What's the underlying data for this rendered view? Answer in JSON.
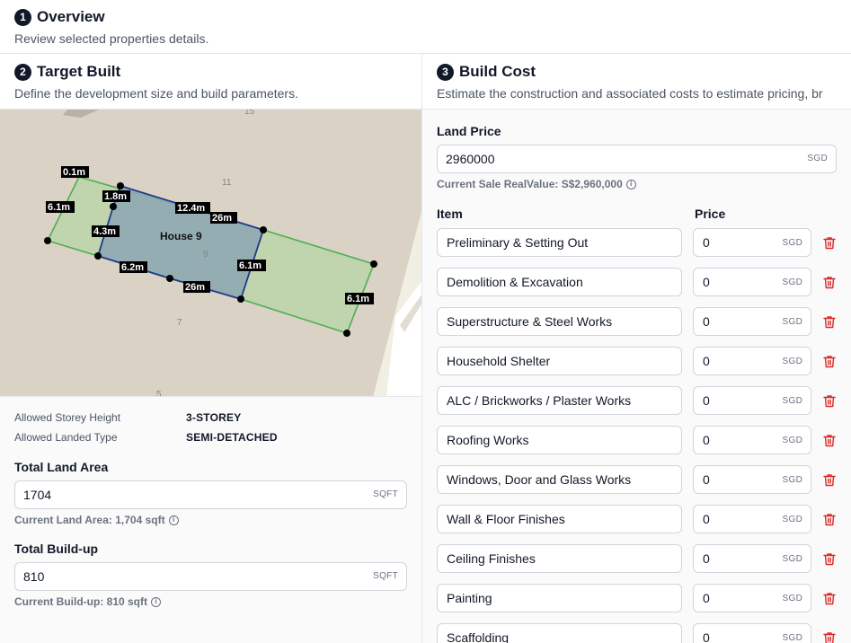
{
  "overview": {
    "step": "1",
    "title": "Overview",
    "subtitle": "Review selected properties details."
  },
  "target_built": {
    "step": "2",
    "title": "Target Built",
    "subtitle": "Define the development size and build parameters.",
    "map": {
      "house_label": "House 9",
      "lot_numbers": [
        "15",
        "11",
        "9",
        "7",
        "5"
      ],
      "dimensions": [
        "0.1m",
        "1.8m",
        "6.1m",
        "12.4m",
        "26m",
        "4.3m",
        "6.2m",
        "26m",
        "6.1m",
        "6.1m"
      ]
    },
    "allowed_storey_height_label": "Allowed Storey Height",
    "allowed_storey_height": "3-STOREY",
    "allowed_landed_type_label": "Allowed Landed Type",
    "allowed_landed_type": "SEMI-DETACHED",
    "total_land_area": {
      "label": "Total Land Area",
      "value": "1704",
      "unit": "SQFT",
      "helper": "Current Land Area: 1,704 sqft"
    },
    "total_build_up": {
      "label": "Total Build-up",
      "value": "810",
      "unit": "SQFT",
      "helper": "Current Build-up: 810 sqft"
    }
  },
  "build_cost": {
    "step": "3",
    "title": "Build Cost",
    "subtitle": "Estimate the construction and associated costs to estimate pricing, br",
    "land_price": {
      "label": "Land Price",
      "value": "2960000",
      "unit": "SGD",
      "helper": "Current Sale RealValue: S$2,960,000"
    },
    "col_item": "Item",
    "col_price": "Price",
    "currency": "SGD",
    "items": [
      {
        "name": "Preliminary & Setting Out",
        "price": "0"
      },
      {
        "name": "Demolition & Excavation",
        "price": "0"
      },
      {
        "name": "Superstructure & Steel Works",
        "price": "0"
      },
      {
        "name": "Household Shelter",
        "price": "0"
      },
      {
        "name": "ALC / Brickworks / Plaster Works",
        "price": "0"
      },
      {
        "name": "Roofing Works",
        "price": "0"
      },
      {
        "name": "Windows, Door and Glass Works",
        "price": "0"
      },
      {
        "name": "Wall & Floor Finishes",
        "price": "0"
      },
      {
        "name": "Ceiling Finishes",
        "price": "0"
      },
      {
        "name": "Painting",
        "price": "0"
      },
      {
        "name": "Scaffolding",
        "price": "0"
      }
    ]
  },
  "colors": {
    "accent_dark": "#111827",
    "delete_red": "#dc2626",
    "plot_green": "#4caf50",
    "building_blue": "#1e3a8a"
  }
}
